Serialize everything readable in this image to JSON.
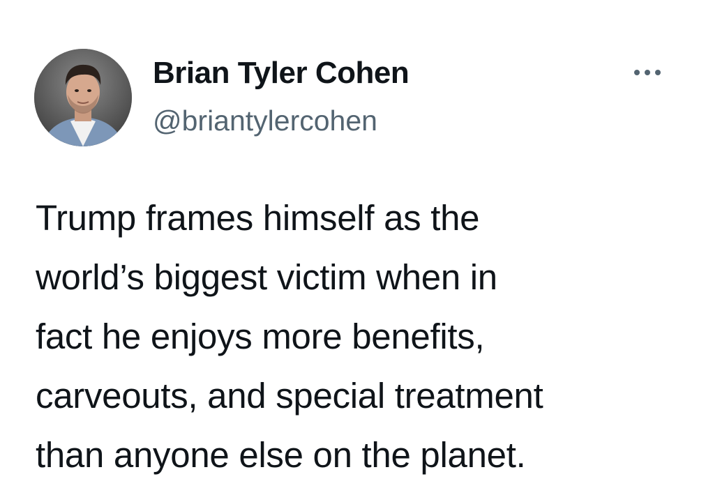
{
  "author": {
    "display_name": "Brian Tyler Cohen",
    "handle": "@briantylercohen",
    "avatar_icon": "profile-photo"
  },
  "more_options_icon": "more-horizontal-icon",
  "tweet": {
    "lines": [
      "Trump frames himself as the",
      "world’s biggest victim when in",
      "fact he enjoys more benefits,",
      "carveouts, and special treatment",
      "than anyone else on the planet."
    ]
  },
  "colors": {
    "text_primary": "#0f1419",
    "text_secondary": "#536471",
    "background": "#ffffff"
  }
}
